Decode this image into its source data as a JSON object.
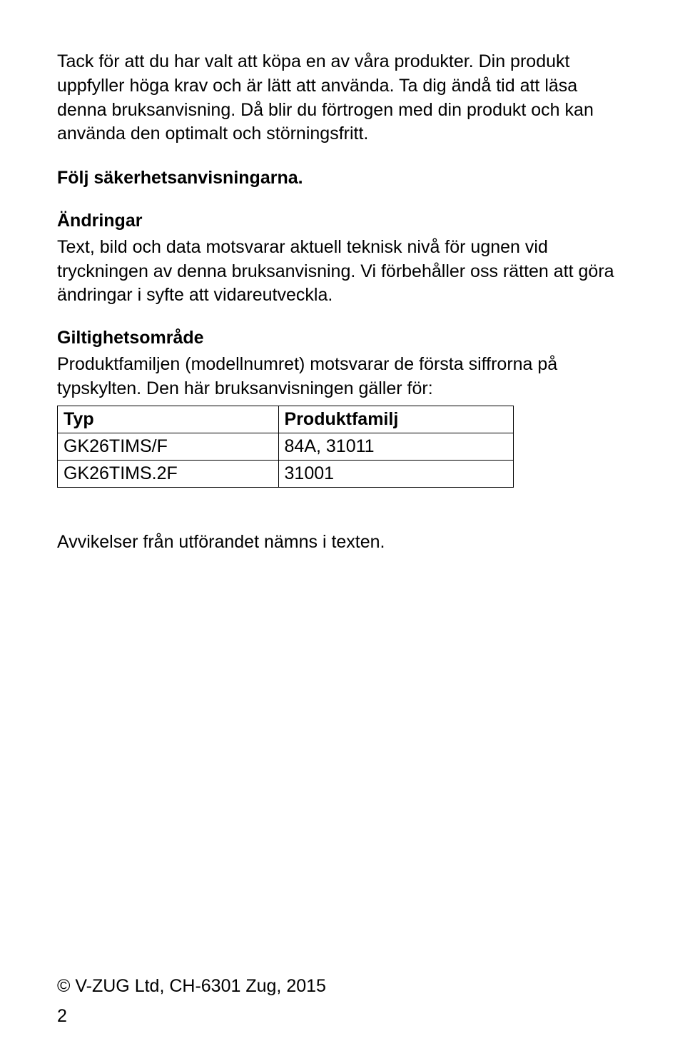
{
  "intro": {
    "p1": "Tack för att du har valt att köpa en av våra produkter. Din produkt uppfyller höga krav och är lätt att använda. Ta dig ändå tid att läsa denna bruksanvisning. Då blir du förtrogen med din produkt och kan använda den optimalt och störningsfritt.",
    "safety": "Följ säkerhetsanvisningarna."
  },
  "changes": {
    "heading": "Ändringar",
    "body": "Text, bild och data motsvarar aktuell teknisk nivå för ugnen vid tryckningen av denna bruksanvisning. Vi förbehåller oss rätten att göra ändringar i syfte att vidareutveckla."
  },
  "validity": {
    "heading": "Giltighetsområde",
    "body": "Produktfamiljen (modellnumret) motsvarar de första siffrorna på typskylten. Den här bruksanvisningen gäller för:"
  },
  "table": {
    "headers": {
      "typ": "Typ",
      "family": "Produktfamilj"
    },
    "rows": [
      {
        "typ": "GK26TIMS/F",
        "family": "84A, 31011"
      },
      {
        "typ": "GK26TIMS.2F",
        "family": "31001"
      }
    ]
  },
  "deviations": "Avvikelser från utförandet nämns i texten.",
  "copyright": "© V-ZUG Ltd, CH-6301 Zug, 2015",
  "page_number": "2"
}
